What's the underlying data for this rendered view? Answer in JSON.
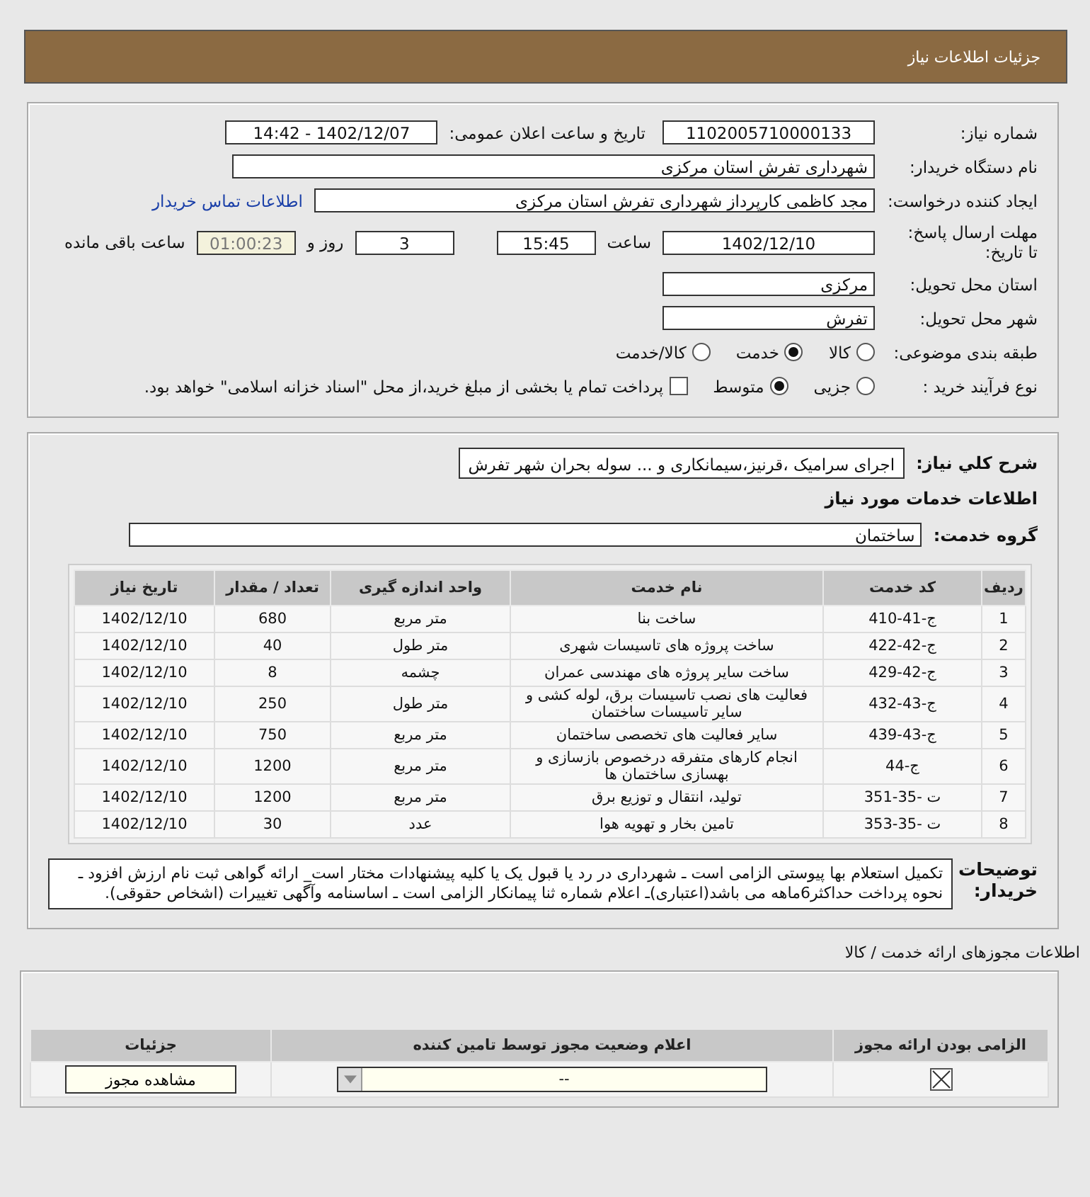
{
  "header": {
    "title": "جزئیات اطلاعات نیاز"
  },
  "form": {
    "need_number": {
      "label": "شماره نیاز:",
      "value": "1102005710000133"
    },
    "announce": {
      "label": "تاریخ و ساعت اعلان عمومی:",
      "value": "1402/12/07 - 14:42"
    },
    "buyer": {
      "label": "نام دستگاه خریدار:",
      "value": "شهرداری تفرش استان مرکزی"
    },
    "creator": {
      "label": "ایجاد کننده درخواست:",
      "value": "مجد کاظمی کارپرداز شهرداری تفرش استان مرکزی",
      "link": "اطلاعات تماس خریدار"
    },
    "deadline": {
      "label": "مهلت ارسال پاسخ: تا تاریخ:",
      "date": "1402/12/10",
      "time_label": "ساعت",
      "time": "15:45",
      "days": "3",
      "days_label": "روز و",
      "remaining": "01:00:23",
      "remaining_label": "ساعت باقی مانده"
    },
    "province": {
      "label": "استان محل تحویل:",
      "value": "مرکزی"
    },
    "city": {
      "label": "شهر محل تحویل:",
      "value": "تفرش"
    },
    "category": {
      "label": "طبقه بندی موضوعی:",
      "options": [
        {
          "label": "کالا",
          "selected": false
        },
        {
          "label": "خدمت",
          "selected": true
        },
        {
          "label": "کالا/خدمت",
          "selected": false
        }
      ]
    },
    "process": {
      "label": "نوع فرآیند خرید :",
      "options": [
        {
          "label": "جزیی",
          "selected": false
        },
        {
          "label": "متوسط",
          "selected": true
        }
      ],
      "treasury": {
        "label": "پرداخت تمام یا بخشی از مبلغ خرید،از محل \"اسناد خزانه اسلامی\" خواهد بود.",
        "checked": false
      }
    }
  },
  "details": {
    "summary_label": "شرح کلي نياز:",
    "summary": "اجرای سرامیک ،قرنیز،سیمانکاری و ... سوله بحران شهر تفرش",
    "services_title": "اطلاعات خدمات مورد نیاز",
    "group_label": "گروه خدمت:",
    "group": "ساختمان",
    "table": {
      "columns": [
        "ردیف",
        "کد خدمت",
        "نام خدمت",
        "واحد اندازه گیری",
        "تعداد / مقدار",
        "تاریخ نیاز"
      ],
      "rows": [
        [
          "1",
          "ج-41-410",
          "ساخت بنا",
          "متر مربع",
          "680",
          "1402/12/10"
        ],
        [
          "2",
          "ج-42-422",
          "ساخت پروژه های تاسیسات شهری",
          "متر طول",
          "40",
          "1402/12/10"
        ],
        [
          "3",
          "ج-42-429",
          "ساخت سایر پروژه های مهندسی عمران",
          "چشمه",
          "8",
          "1402/12/10"
        ],
        [
          "4",
          "ج-43-432",
          "فعالیت های نصب تاسیسات برق، لوله کشی و سایر تاسیسات ساختمان",
          "متر طول",
          "250",
          "1402/12/10"
        ],
        [
          "5",
          "ج-43-439",
          "سایر فعالیت های تخصصی ساختمان",
          "متر مربع",
          "750",
          "1402/12/10"
        ],
        [
          "6",
          "ج-44",
          "انجام کارهای متفرقه درخصوص بازسازی و بهسازی ساختمان ها",
          "متر مربع",
          "1200",
          "1402/12/10"
        ],
        [
          "7",
          "ت -35-351",
          "تولید، انتقال و توزیع برق",
          "متر مربع",
          "1200",
          "1402/12/10"
        ],
        [
          "8",
          "ت -35-353",
          "تامین بخار و تهویه هوا",
          "عدد",
          "30",
          "1402/12/10"
        ]
      ]
    },
    "notes_label": "توضیحات خریدار:",
    "notes": "تکمیل استعلام بها پیوستی الزامی است ـ شهرداری در رد یا قبول یک یا کلیه پیشنهادات مختار است_ ارائه گواهی ثبت نام ارزش افزود ـ نحوه پرداخت حداکثر6ماهه می باشد(اعتباری)ـ اعلام شماره ثنا پیمانکار الزامی است ـ اساسنامه وآگهی تغییرات (اشخاص حقوقی)."
  },
  "licenses": {
    "title": "اطلاعات مجوزهای ارائه خدمت / کالا",
    "columns": [
      "الزامی بودن ارائه مجوز",
      "اعلام وضعیت مجوز توسط تامین کننده",
      "جزئیات"
    ],
    "rows": [
      {
        "required": true,
        "status": "--",
        "button": "مشاهده مجوز"
      }
    ]
  }
}
